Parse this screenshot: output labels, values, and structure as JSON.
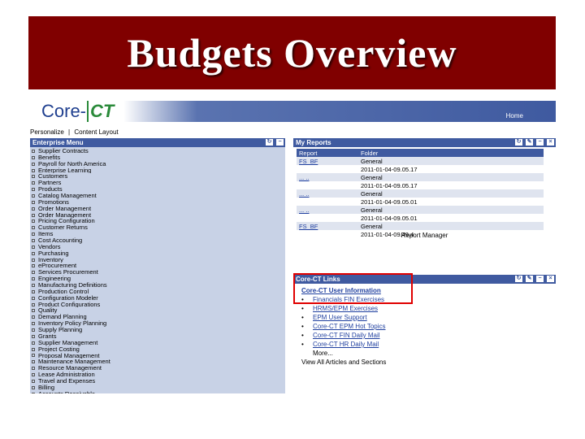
{
  "title": "Budgets Overview",
  "colors": {
    "title_bar": "#800000",
    "header_blue": "#3f5aa0",
    "menu_bg": "#c8d2e6",
    "highlight": "#e00000",
    "link": "#1f3f9f"
  },
  "app": {
    "logo_core": "Core-",
    "logo_ct": "CT",
    "home_label": "Home",
    "personalize_label": "Personalize",
    "personalize_separator": "|",
    "content_layout_label": "Content Layout"
  },
  "enterprise_menu": {
    "title": "Enterprise Menu",
    "items": [
      "Supplier Contracts",
      "Benefits",
      "Payroll for North America",
      "Enterprise Learning",
      "Customers",
      "Partners",
      "Products",
      "Catalog Management",
      "Promotions",
      "Order Management",
      "Order Management",
      "Pricing Configuration",
      "Customer Returns",
      "Items",
      "Cost Accounting",
      "Vendors",
      "Purchasing",
      "Inventory",
      "eProcurement",
      "Services Procurement",
      "Engineering",
      "Manufacturing Definitions",
      "Production Control",
      "Configuration Modeler",
      "Product Configurations",
      "Quality",
      "Demand Planning",
      "Inventory Policy Planning",
      "Supply Planning",
      "Grants",
      "Supplier Management",
      "Project Costing",
      "Proposal Management",
      "Maintenance Management",
      "Resource Management",
      "Lease Administration",
      "Travel and Expenses",
      "Billing",
      "Accounts Receivable"
    ]
  },
  "my_reports": {
    "title": "My Reports",
    "columns": [
      "Report",
      "Folder"
    ],
    "rows": [
      {
        "report": "FS_BF",
        "folder": "General",
        "alt": true
      },
      {
        "report": "",
        "folder": "2011-01-04-09.05.17",
        "alt": false
      },
      {
        "report": "... ..",
        "folder": "General",
        "alt": true
      },
      {
        "report": "",
        "folder": "2011-01-04-09.05.17",
        "alt": false
      },
      {
        "report": "... ..",
        "folder": "General",
        "alt": true
      },
      {
        "report": "",
        "folder": "2011-01-04-09.05.01",
        "alt": false
      },
      {
        "report": "... ..",
        "folder": "General",
        "alt": true
      },
      {
        "report": "",
        "folder": "2011-01-04-09.05.01",
        "alt": false
      },
      {
        "report": "FS_BF",
        "folder": "General",
        "alt": true
      },
      {
        "report": "",
        "folder": "2011-01-04-09.49.4",
        "alt": false
      }
    ],
    "footer_link": "Report Manager"
  },
  "core_ct_links": {
    "title": "Core-CT Links",
    "items": [
      {
        "text": "Core-CT User Information",
        "bullet": ""
      },
      {
        "text": "Financials FIN Exercises",
        "bullet": "•"
      },
      {
        "text": "HRMS/EPM Exercises",
        "bullet": "•"
      },
      {
        "text": "EPM User Support",
        "bullet": "•"
      },
      {
        "text": "Core-CT EPM Hot Topics",
        "bullet": "•"
      },
      {
        "text": "Core-CT FIN Daily Mail",
        "bullet": "•"
      },
      {
        "text": "Core-CT HR Daily Mail",
        "bullet": "•"
      }
    ],
    "more_label": "More...",
    "view_all_label": "View All Articles and Sections"
  }
}
